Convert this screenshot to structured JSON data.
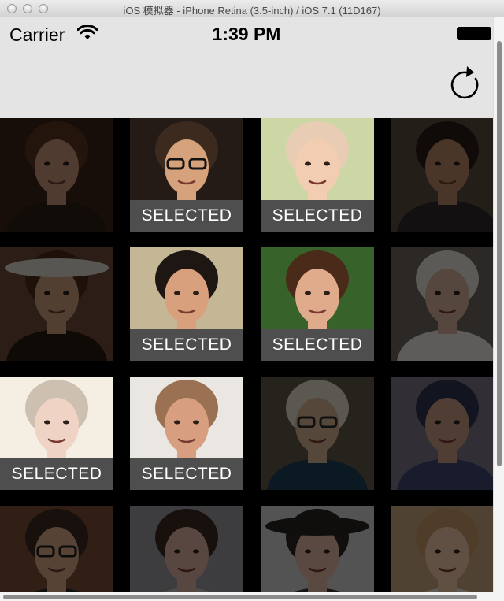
{
  "window": {
    "title": "iOS 模拟器 - iPhone Retina (3.5-inch) / iOS 7.1 (11D167)"
  },
  "status_bar": {
    "carrier": "Carrier",
    "time": "1:39 PM"
  },
  "nav_bar": {
    "refresh_icon": "refresh-icon"
  },
  "selected_label": "SELECTED",
  "photos": [
    {
      "id": "woman-bangs-brown-hair",
      "selected": false,
      "colors": {
        "bg": "#3a2418",
        "skin": "#c69378",
        "hair": "#5a3520",
        "shirt": "#2b1e16"
      }
    },
    {
      "id": "man-aviator-sunglasses",
      "selected": true,
      "colors": {
        "bg": "#241b16",
        "skin": "#d5a27c",
        "hair": "#3c2a1e",
        "shirt": "#1c1c1c",
        "glasses": "#141414"
      }
    },
    {
      "id": "baby-under-blanket",
      "selected": true,
      "colors": {
        "bg": "#cdd7a6",
        "skin": "#f2cdb2",
        "hair": "#e8cdb4",
        "shirt": "#e9ddc9"
      }
    },
    {
      "id": "bearded-man-name-tag",
      "selected": false,
      "colors": {
        "bg": "#5a4d40",
        "skin": "#b98566",
        "hair": "#2a1d16",
        "shirt": "#2e2a29"
      }
    },
    {
      "id": "woman-wide-hat",
      "selected": false,
      "colors": {
        "bg": "#6e4b38",
        "skin": "#caa07c",
        "hair": "#4a2c1a",
        "shirt": "#2a1a12",
        "hat": "#ddd7cf"
      }
    },
    {
      "id": "smiling-man-phone",
      "selected": true,
      "colors": {
        "bg": "#c5b796",
        "skin": "#d9a07e",
        "hair": "#1d1612",
        "shirt": "#b9c8d6"
      }
    },
    {
      "id": "woman-smile-earrings",
      "selected": true,
      "colors": {
        "bg": "#37632b",
        "skin": "#e0ab8b",
        "hair": "#4a2a18",
        "shirt": "#5a3a2a"
      }
    },
    {
      "id": "elderly-man-uniform",
      "selected": false,
      "colors": {
        "bg": "#6e655c",
        "skin": "#d8b29c",
        "hair": "#e6e0d8",
        "shirt": "#e9e7e2"
      }
    },
    {
      "id": "blonde-woman-blue-eyes",
      "selected": true,
      "colors": {
        "bg": "#f4eee3",
        "skin": "#efd4c6",
        "hair": "#cdc0b1",
        "shirt": "#d9c9bc"
      }
    },
    {
      "id": "man-short-hair-suit",
      "selected": true,
      "colors": {
        "bg": "#eae6e1",
        "skin": "#d79f7f",
        "hair": "#9a7152",
        "shirt": "#2a2a2c"
      }
    },
    {
      "id": "elderly-woman-headscarf",
      "selected": false,
      "colors": {
        "bg": "#5e5848",
        "skin": "#d8b194",
        "hair": "#e4dccb",
        "shirt": "#1d3f58",
        "glasses": "#2a2a2a"
      }
    },
    {
      "id": "old-man-cap",
      "selected": false,
      "colors": {
        "bg": "#7a7484",
        "skin": "#c89c84",
        "hair": "#2d3550",
        "shirt": "#3c4870"
      }
    },
    {
      "id": "young-man-glasses",
      "selected": false,
      "colors": {
        "bg": "#7a4e38",
        "skin": "#d9a588",
        "hair": "#3b2820",
        "shirt": "#2c2623",
        "glasses": "#1c1c1c"
      }
    },
    {
      "id": "woman-yawning",
      "selected": false,
      "colors": {
        "bg": "#9a9aa0",
        "skin": "#dcaea0",
        "hair": "#3a2a22",
        "shirt": "#c9bdb6"
      }
    },
    {
      "id": "man-hat-closeup",
      "selected": false,
      "colors": {
        "bg": "#cfcfcf",
        "skin": "#dfb7a1",
        "hair": "#2a2624",
        "shirt": "#3a3532",
        "hat": "#272322"
      }
    },
    {
      "id": "smiling-baby",
      "selected": false,
      "colors": {
        "bg": "#c9a57e",
        "skin": "#f0c9ab",
        "hair": "#c79868",
        "shirt": "#f0e4d8"
      }
    }
  ]
}
